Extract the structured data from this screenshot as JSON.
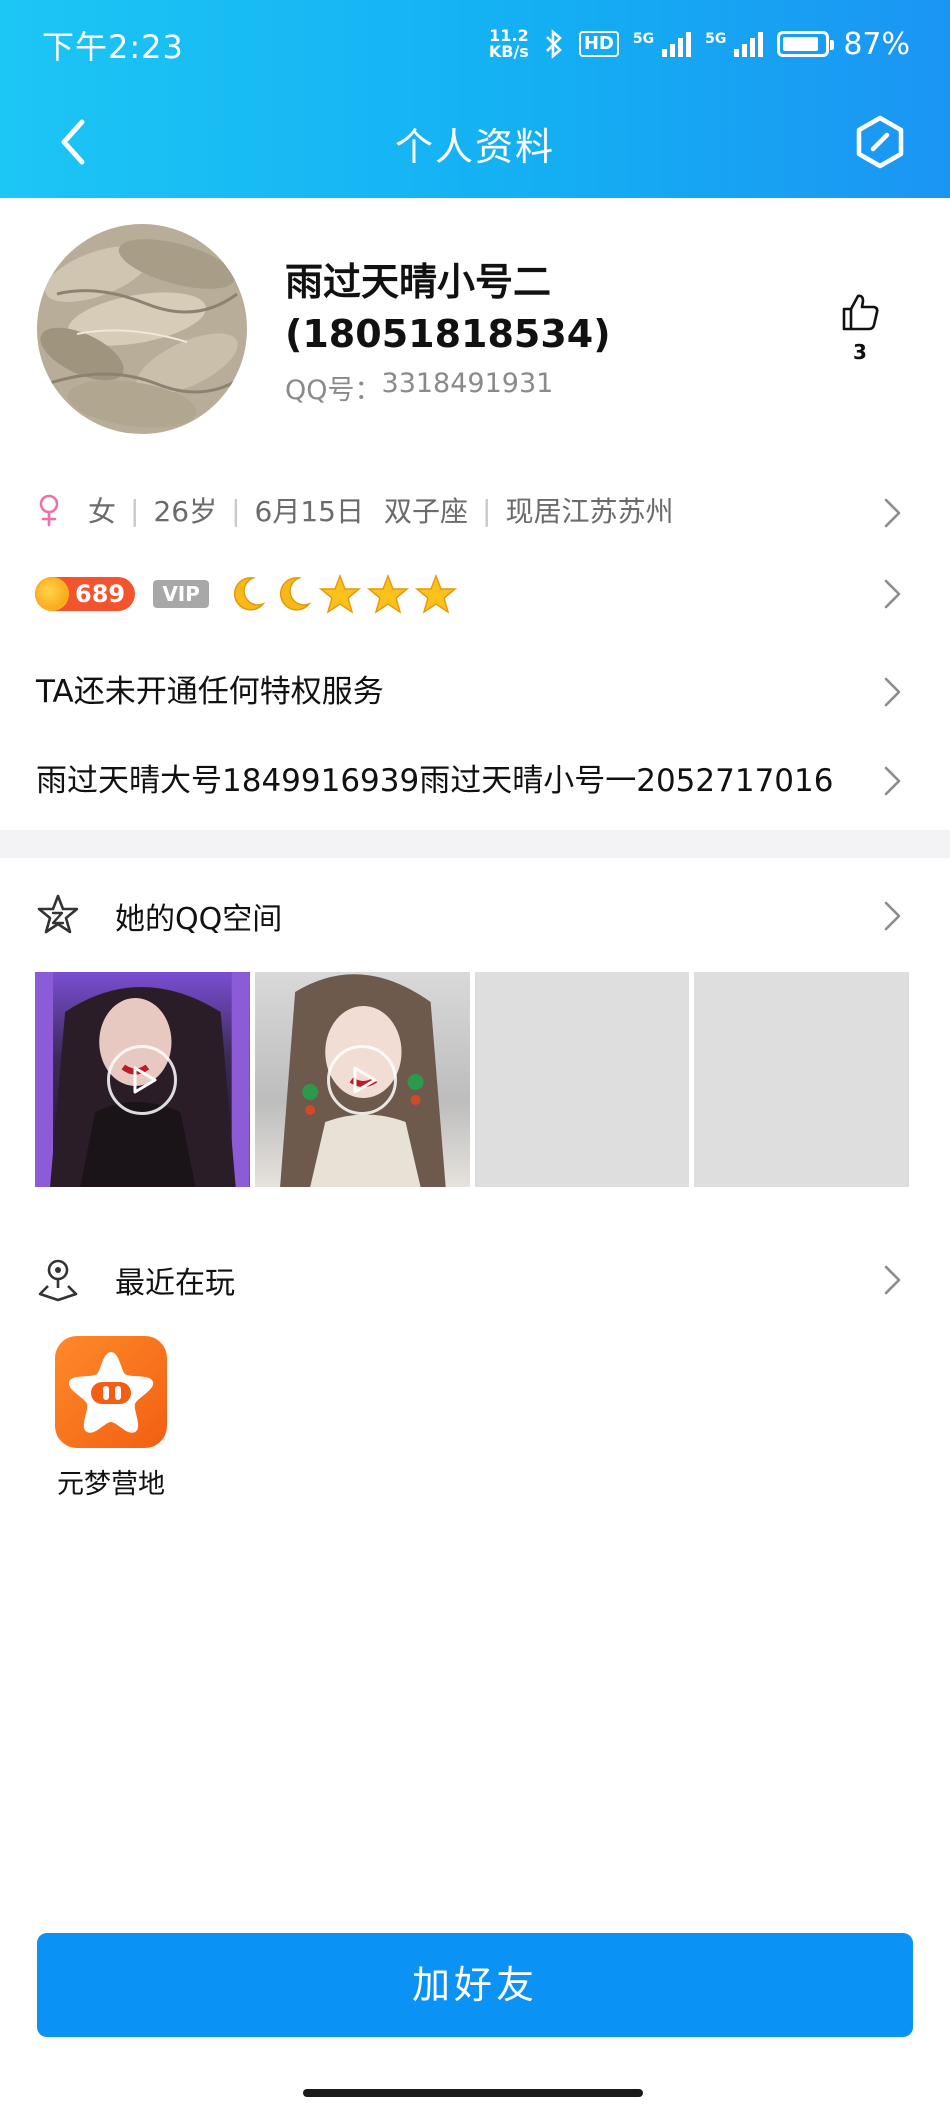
{
  "status_bar": {
    "time": "下午2:23",
    "net_speed_value": "11.2",
    "net_speed_unit": "KB/s",
    "hd_label": "HD",
    "signal_1_label": "5G",
    "signal_2_label": "5G",
    "battery_percent": "87%",
    "battery_level": 0.87
  },
  "nav": {
    "title": "个人资料",
    "back_icon": "chevron-left-icon",
    "action_icon": "hexagon-edit-icon"
  },
  "profile": {
    "name_line1": "雨过天晴小号二",
    "name_line2": "(18051818534)",
    "qq_label": "QQ号：",
    "qq_number": "3318491931",
    "likes": "3"
  },
  "info": {
    "gender": "女",
    "age": "26岁",
    "birthday": "6月15日",
    "zodiac": "双子座",
    "location": "现居江苏苏州"
  },
  "badges": {
    "level": "689",
    "vip_label": "VIP",
    "rank_icons": [
      "moon",
      "moon",
      "star",
      "star",
      "star"
    ]
  },
  "privilege_text": "TA还未开通任何特权服务",
  "note_text": "雨过天晴大号1849916939雨过天晴小号一2052717016",
  "qzone": {
    "title": "她的QQ空间",
    "photos": [
      {
        "kind": "video"
      },
      {
        "kind": "video"
      },
      {
        "kind": "empty"
      },
      {
        "kind": "empty"
      }
    ]
  },
  "recent": {
    "title": "最近在玩",
    "games": [
      {
        "label": "元梦营地"
      }
    ]
  },
  "action_button": "加好友",
  "colors": {
    "header_start": "#1cc6f5",
    "header_end": "#1b95f3",
    "button": "#0a93f4",
    "level_badge": "#f3542e"
  }
}
